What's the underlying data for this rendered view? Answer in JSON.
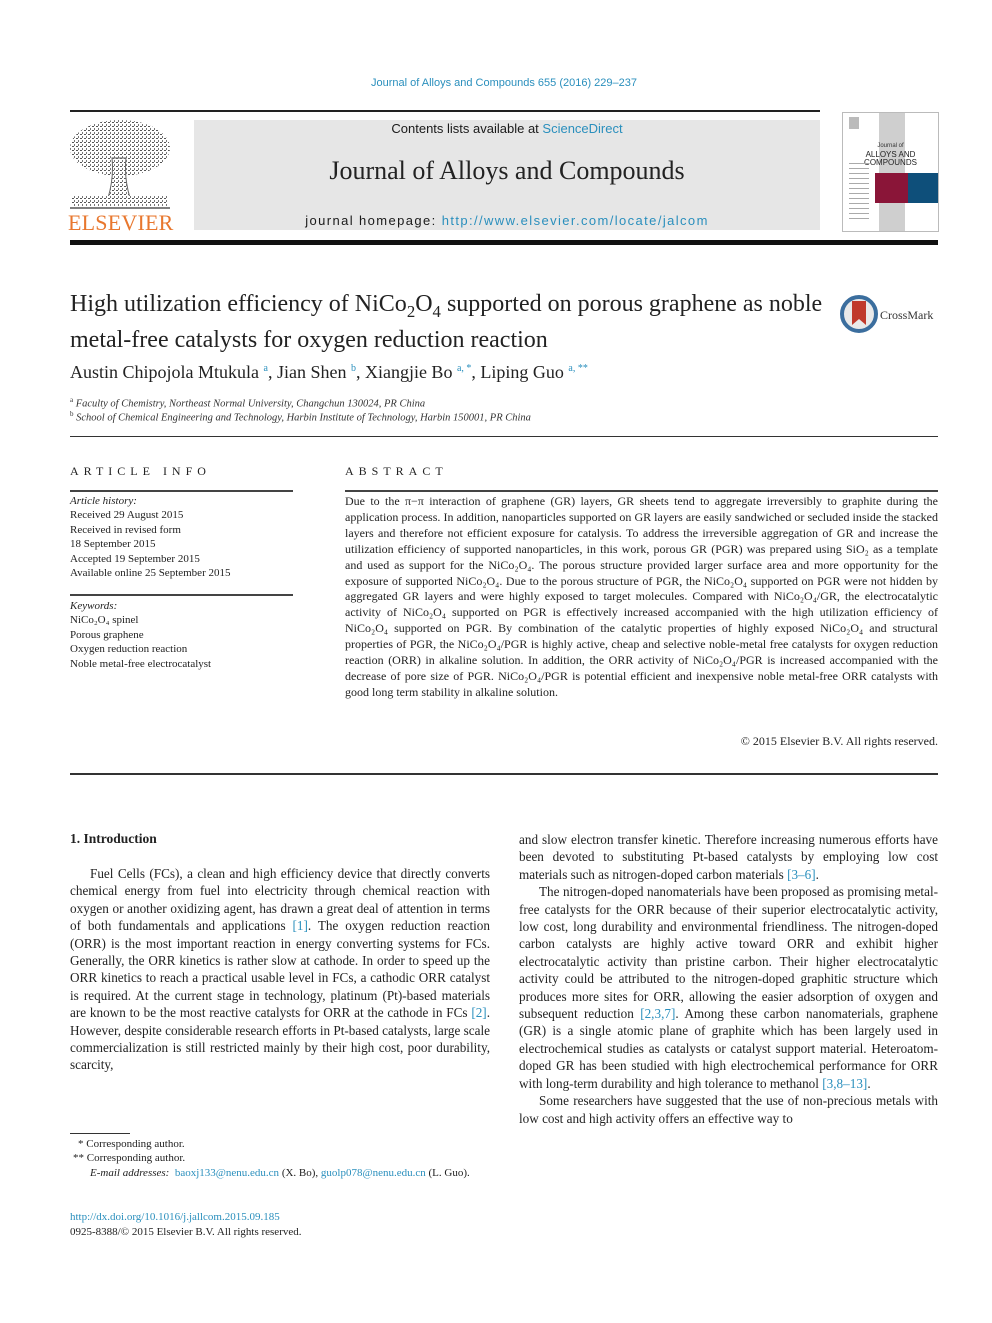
{
  "header": {
    "citation": "Journal of Alloys and Compounds 655 (2016) 229–237",
    "contents_prefix": "Contents lists available at ",
    "contents_link": "ScienceDirect",
    "journal_name": "Journal of Alloys and Compounds",
    "homepage_prefix": "journal homepage: ",
    "homepage_url": "http://www.elsevier.com/locate/jalcom",
    "publisher_logo_text": "ELSEVIER",
    "cover": {
      "title_top": "Journal of",
      "title_bottom": "ALLOYS AND COMPOUNDS",
      "colors": {
        "red": "#8a1538",
        "blue": "#0e4f7a"
      }
    }
  },
  "article": {
    "title_parts": [
      "High utilization efficiency of NiCo",
      "2",
      "O",
      "4",
      " supported on porous graphene as noble metal-free catalysts for oxygen reduction reaction"
    ],
    "crossmark_label": "CrossMark",
    "authors": [
      {
        "name": "Austin Chipojola Mtukula",
        "sup": "a"
      },
      {
        "name": "Jian Shen",
        "sup": "b"
      },
      {
        "name": "Xiangjie Bo",
        "sup": "a, *"
      },
      {
        "name": "Liping Guo",
        "sup": "a, **"
      }
    ],
    "affiliations": [
      {
        "mark": "a",
        "text": "Faculty of Chemistry, Northeast Normal University, Changchun 130024, PR China"
      },
      {
        "mark": "b",
        "text": "School of Chemical Engineering and Technology, Harbin Institute of Technology, Harbin 150001, PR China"
      }
    ]
  },
  "article_info": {
    "heading": "ARTICLE INFO",
    "history_label": "Article history:",
    "history": [
      "Received 29 August 2015",
      "Received in revised form",
      "18 September 2015",
      "Accepted 19 September 2015",
      "Available online 25 September 2015"
    ],
    "keywords_label": "Keywords:",
    "keywords": [
      "NiCo₂O₄ spinel",
      "Porous graphene",
      "Oxygen reduction reaction",
      "Noble metal-free electrocatalyst"
    ]
  },
  "abstract": {
    "heading": "ABSTRACT",
    "text": "Due to the π−π interaction of graphene (GR) layers, GR sheets tend to aggregate irreversibly to graphite during the application process. In addition, nanoparticles supported on GR layers are easily sandwiched or secluded inside the stacked layers and therefore not efficient exposure for catalysis. To address the irreversible aggregation of GR and increase the utilization efficiency of supported nanoparticles, in this work, porous GR (PGR) was prepared using SiO₂ as a template and used as support for the NiCo₂O₄. The porous structure provided larger surface area and more opportunity for the exposure of supported NiCo₂O₄. Due to the porous structure of PGR, the NiCo₂O₄ supported on PGR were not hidden by aggregated GR layers and were highly exposed to target molecules. Compared with NiCo₂O₄/GR, the electrocatalytic activity of NiCo₂O₄ supported on PGR is effectively increased accompanied with the high utilization efficiency of NiCo₂O₄ supported on PGR. By combination of the catalytic properties of highly exposed NiCo₂O₄ and structural properties of PGR, the NiCo₂O₄/PGR is highly active, cheap and selective noble-metal free catalysts for oxygen reduction reaction (ORR) in alkaline solution. In addition, the ORR activity of NiCo₂O₄/PGR is increased accompanied with the decrease of pore size of PGR. NiCo₂O₄/PGR is potential efficient and inexpensive noble metal-free ORR catalysts with good long term stability in alkaline solution.",
    "copyright": "© 2015 Elsevier B.V. All rights reserved."
  },
  "body": {
    "section_heading": "1.  Introduction",
    "left_paragraph": {
      "segments": [
        {
          "text": "Fuel Cells (FCs), a clean and high efficiency device that directly converts chemical energy from fuel into electricity through chemical reaction with oxygen or another oxidizing agent, has drawn a great deal of attention in terms of both fundamentals and applications "
        },
        {
          "ref": "[1]"
        },
        {
          "text": ". The oxygen reduction reaction (ORR) is the most important reaction in energy converting systems for FCs. Generally, the ORR kinetics is rather slow at cathode. In order to speed up the ORR kinetics to reach a practical usable level in FCs, a cathodic ORR catalyst is required. At the current stage in technology, platinum (Pt)-based materials are known to be the most reactive catalysts for ORR at the cathode in FCs "
        },
        {
          "ref": "[2]"
        },
        {
          "text": ". However, despite considerable research efforts in Pt-based catalysts, large scale commercialization is still restricted mainly by their high cost, poor durability, scarcity,"
        }
      ]
    },
    "right_paragraphs": [
      {
        "seg1": "and slow electron transfer kinetic. Therefore increasing numerous efforts have been devoted to substituting Pt-based catalysts by employing low cost materials such as nitrogen-doped carbon materials ",
        "ref1": "[3–6]",
        "seg2": "."
      },
      {
        "seg1": "The nitrogen-doped nanomaterials have been proposed as promising metal-free catalysts for the ORR because of their superior electrocatalytic activity, low cost, long durability and environmental friendliness. The nitrogen-doped carbon catalysts are highly active toward ORR and exhibit higher electrocatalytic activity than pristine carbon. Their higher electrocatalytic activity could be attributed to the nitrogen-doped graphitic structure which produces more sites for ORR, allowing the easier adsorption of oxygen and subsequent reduction ",
        "ref1": "[2,3,7]",
        "seg2": ". Among these carbon nanomaterials, graphene (GR) is a single atomic plane of graphite which has been largely used in electrochemical studies as catalysts or catalyst support material. Heteroatom-doped GR has been studied with high electrochemical performance for ORR with long-term durability and high tolerance to methanol ",
        "ref2": "[3,8–13]",
        "seg3": "."
      },
      {
        "seg1": "Some researchers have suggested that the use of non-precious metals with low cost and high activity offers an effective way to"
      }
    ]
  },
  "footnotes": {
    "star1": "* Corresponding author.",
    "star2": "** Corresponding author.",
    "email_label": "E-mail addresses:",
    "email1": "baoxj133@nenu.edu.cn",
    "email1_owner": " (X. Bo), ",
    "email2": "guolp078@nenu.edu.cn",
    "email2_owner": " (L. Guo).",
    "doi": "http://dx.doi.org/10.1016/j.jallcom.2015.09.185",
    "issn": "0925-8388/© 2015 Elsevier B.V. All rights reserved."
  }
}
